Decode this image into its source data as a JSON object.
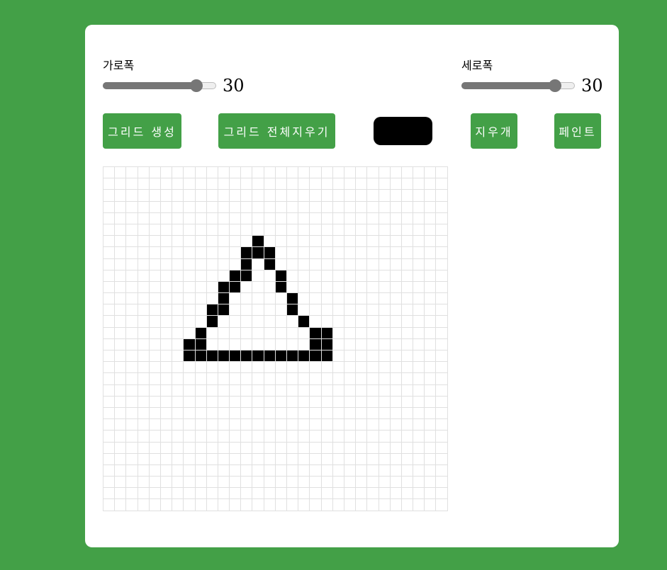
{
  "width_slider": {
    "label": "가로폭",
    "value": "30",
    "fraction": 0.82
  },
  "height_slider": {
    "label": "세로폭",
    "value": "30",
    "fraction": 0.82
  },
  "buttons": {
    "create_grid": "그리드 생성",
    "clear_grid": "그리드 전체지우기",
    "eraser": "지우개",
    "paint": "페인트"
  },
  "paint_color": "#000000",
  "accent_color": "#43a047",
  "grid": {
    "rows": 30,
    "cols": 30,
    "filled_cells": [
      [
        6,
        13
      ],
      [
        7,
        12
      ],
      [
        7,
        13
      ],
      [
        7,
        14
      ],
      [
        8,
        12
      ],
      [
        8,
        14
      ],
      [
        9,
        11
      ],
      [
        9,
        12
      ],
      [
        9,
        15
      ],
      [
        10,
        10
      ],
      [
        10,
        11
      ],
      [
        10,
        15
      ],
      [
        11,
        10
      ],
      [
        11,
        16
      ],
      [
        12,
        9
      ],
      [
        12,
        10
      ],
      [
        12,
        16
      ],
      [
        13,
        9
      ],
      [
        13,
        17
      ],
      [
        14,
        8
      ],
      [
        14,
        18
      ],
      [
        14,
        19
      ],
      [
        15,
        7
      ],
      [
        15,
        8
      ],
      [
        15,
        18
      ],
      [
        15,
        19
      ],
      [
        16,
        7
      ],
      [
        16,
        8
      ],
      [
        16,
        9
      ],
      [
        16,
        10
      ],
      [
        16,
        11
      ],
      [
        16,
        12
      ],
      [
        16,
        13
      ],
      [
        16,
        14
      ],
      [
        16,
        15
      ],
      [
        16,
        16
      ],
      [
        16,
        17
      ],
      [
        16,
        18
      ],
      [
        16,
        19
      ]
    ]
  }
}
